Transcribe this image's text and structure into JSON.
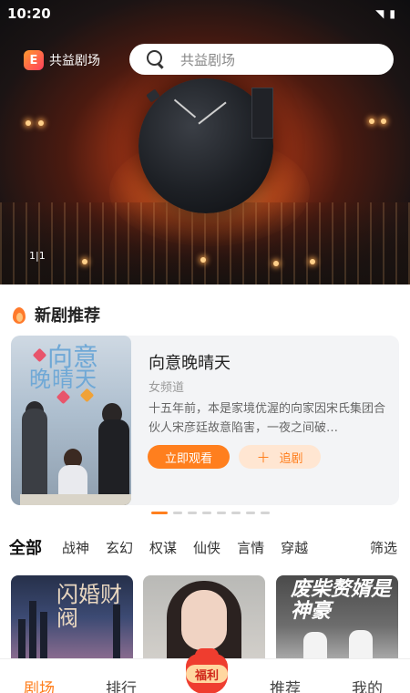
{
  "status_bar": {
    "time": "10:20"
  },
  "header": {
    "brand_logo_text": "E",
    "brand_name": "共益剧场",
    "search_placeholder": "共益剧场"
  },
  "banner": {
    "page_counter": "1|1"
  },
  "section": {
    "title": "新剧推荐",
    "card": {
      "title": "向意晚晴天",
      "tag": "女频道",
      "description": "十五年前，本是家境优渥的向家因宋氏集团合伙人宋彦廷故意陷害，一夜之间破…",
      "watch_label": "立即观看",
      "follow_label": "追剧",
      "poster_title_line1": "向意",
      "poster_title_line2": "晚晴天"
    },
    "carousel_dots": 8,
    "active_dot": 0
  },
  "categories": {
    "items": [
      "全部",
      "战神",
      "玄幻",
      "权谋",
      "仙侠",
      "言情",
      "穿越"
    ],
    "active": "全部",
    "filter_label": "筛选"
  },
  "thumbnails": {
    "first_text": "闪婚财阀",
    "third_text": "废柴赘婿是神豪"
  },
  "tabbar": {
    "home": "剧场",
    "rank": "排行",
    "welfare": "福利",
    "recommend": "推荐",
    "mine": "我的",
    "active_color": "#ff7f1e"
  },
  "colors": {
    "accent": "#ff7f1e",
    "accent_light": "#ffe6d2",
    "welfare_red": "#ef3d2f"
  }
}
